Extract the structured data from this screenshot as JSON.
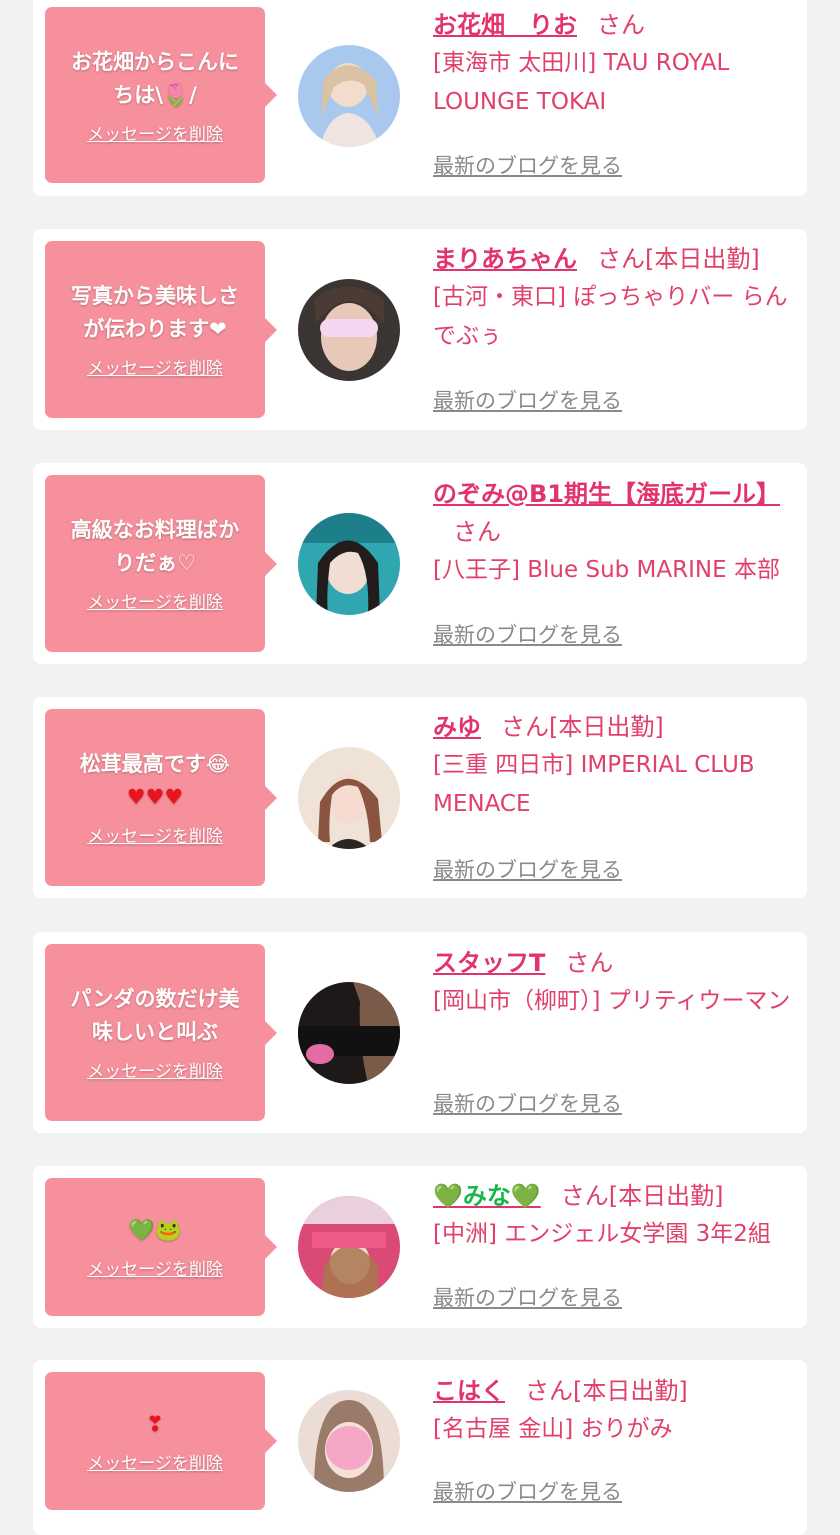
{
  "delete_label": "メッセージを削除",
  "blog_label": "最新のブログを見る",
  "san_suffix": "さん",
  "cards": [
    {
      "message_lines": [
        "お花畑からこんに",
        "ちは\\🌷/"
      ],
      "name": "お花畑　りお",
      "status": "さん",
      "shop": "[東海市 太田川] TAU ROYAL LOUNGE TOKAI"
    },
    {
      "message_lines": [
        "写真から美味しさ",
        "が伝わります❤"
      ],
      "name": "まりあちゃん",
      "status": "さん[本日出勤]",
      "shop": "[古河・東口] ぽっちゃりバー らんでぶぅ"
    },
    {
      "message_lines": [
        "高級なお料理ばか",
        "りだぁ♡"
      ],
      "name": "のぞみ@B1期生【海底ガール】",
      "status": "さん",
      "shop": "[八王子] Blue Sub MARINE 本部"
    },
    {
      "message_lines": [
        "松茸最高です😂",
        "♥♥♥"
      ],
      "name": "みゆ",
      "status": "さん[本日出勤]",
      "shop": "[三重 四日市] IMPERIAL CLUB MENACE"
    },
    {
      "message_lines": [
        "パンダの数だけ美",
        "味しいと叫ぶ"
      ],
      "name": "スタッフT",
      "status": "さん",
      "shop": "[岡山市（柳町）] プリティウーマン"
    },
    {
      "message_lines": [
        "💚🐸"
      ],
      "name": "💚みな💚",
      "status": "さん[本日出勤]",
      "shop": "[中洲] エンジェル女学園 3年2組"
    },
    {
      "message_lines": [
        "❣"
      ],
      "name": "こはく",
      "status": "さん[本日出勤]",
      "shop": "[名古屋 金山] おりがみ"
    }
  ],
  "colors": {
    "accent": "#e2336a",
    "bubble": "#f6909c",
    "background": "#f2f2f2"
  }
}
